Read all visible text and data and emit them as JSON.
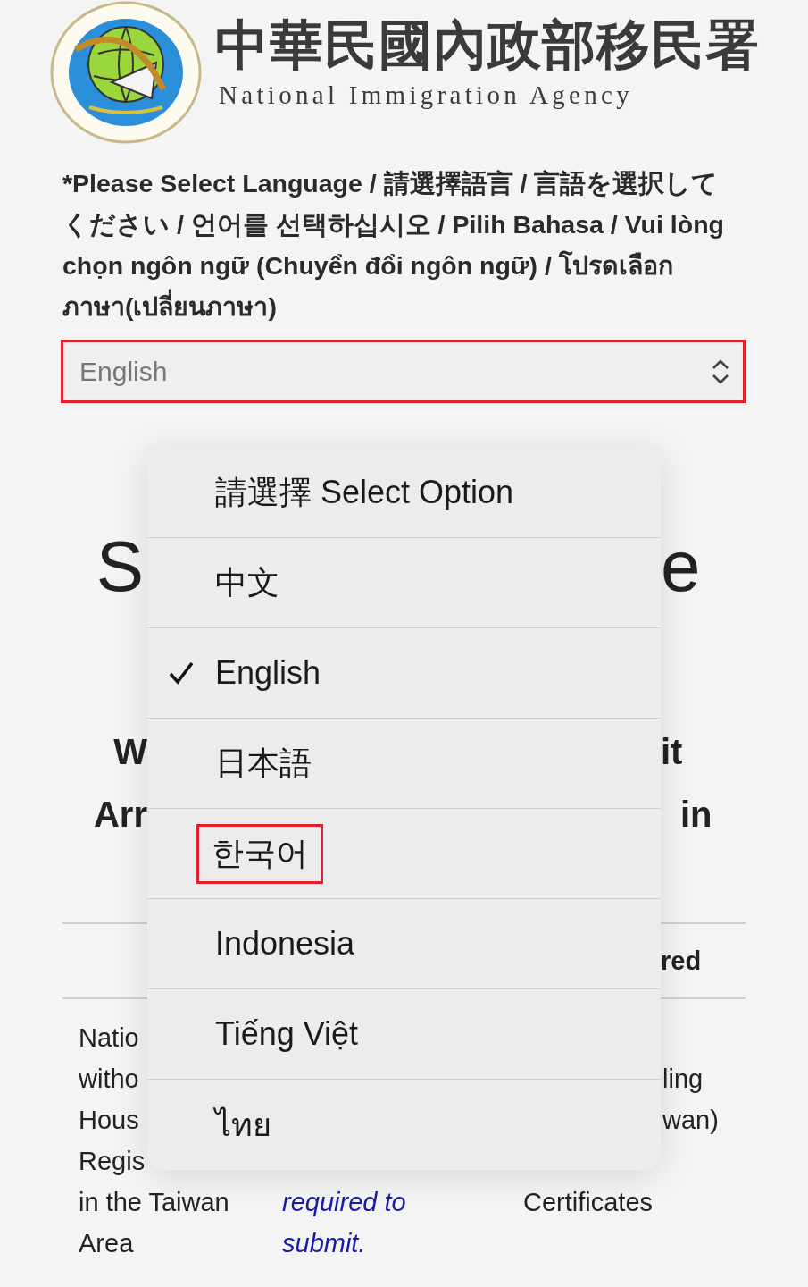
{
  "header": {
    "title_zh": "中華民國內政部移民署",
    "title_en": "National Immigration Agency"
  },
  "language_prompt": "*Please Select Language / 請選擇語言 / 言語を選択してください / 언어를 선택하십시오 / Pilih Bahasa / Vui lòng chọn ngôn ngữ (Chuyển đổi ngôn ngữ) / โปรดเลือกภาษา(เปลี่ยนภาษา)",
  "language_select": {
    "value": "English",
    "highlighted": true
  },
  "background": {
    "heading_left": "S",
    "heading_right": "e",
    "subheading_left": [
      "W",
      "Arr"
    ],
    "subheading_right": [
      "it",
      "in"
    ],
    "table_header_right": "red",
    "cells_left": [
      "Natio",
      "witho",
      "Hous",
      "Regis",
      "in the Taiwan",
      "Area"
    ],
    "cells_middle": [
      "required to",
      "submit."
    ],
    "cells_right_fragment": [
      "ling",
      "wan)"
    ],
    "cells_right": [
      "Certificates"
    ]
  },
  "menu_options": [
    {
      "label": "請選擇 Select Option",
      "selected": false,
      "highlighted": false
    },
    {
      "label": "中文",
      "selected": false,
      "highlighted": false
    },
    {
      "label": "English",
      "selected": true,
      "highlighted": false
    },
    {
      "label": "日本語",
      "selected": false,
      "highlighted": false
    },
    {
      "label": "한국어",
      "selected": false,
      "highlighted": true
    },
    {
      "label": "Indonesia",
      "selected": false,
      "highlighted": false
    },
    {
      "label": "Tiếng Việt",
      "selected": false,
      "highlighted": false
    },
    {
      "label": "ไทย",
      "selected": false,
      "highlighted": false
    }
  ]
}
